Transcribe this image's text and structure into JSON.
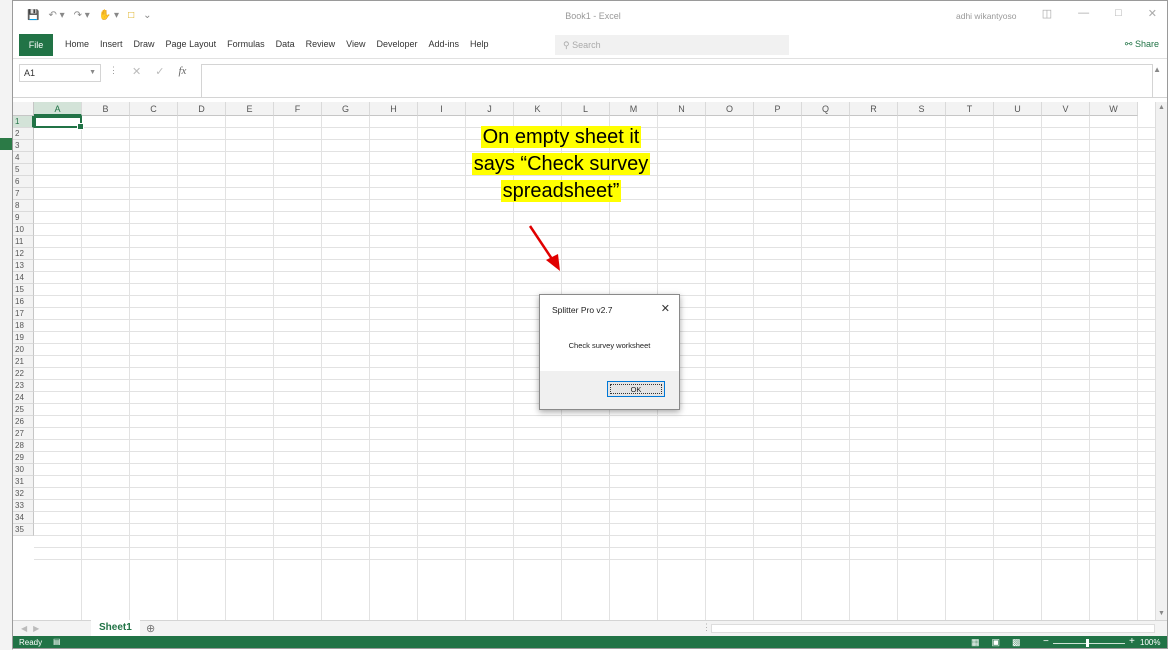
{
  "titlebar": {
    "doc_title": "Book1 - Excel",
    "user": "adhi wikantyoso",
    "window_controls": [
      "ribbon-display-icon",
      "minimize-icon",
      "restore-icon",
      "close-icon"
    ]
  },
  "ribbon": {
    "file_label": "File",
    "tabs": [
      "Home",
      "Insert",
      "Draw",
      "Page Layout",
      "Formulas",
      "Data",
      "Review",
      "View",
      "Developer",
      "Add-ins",
      "Help"
    ],
    "search_placeholder": "Search",
    "share_label": "Share"
  },
  "formula_bar": {
    "name_box": "A1",
    "fx_label": "fx",
    "value": ""
  },
  "grid": {
    "columns": [
      "A",
      "B",
      "C",
      "D",
      "E",
      "F",
      "G",
      "H",
      "I",
      "J",
      "K",
      "L",
      "M",
      "N",
      "O",
      "P",
      "Q",
      "R",
      "S",
      "T",
      "U",
      "V",
      "W"
    ],
    "rows": [
      "1",
      "2",
      "3",
      "4",
      "5",
      "6",
      "7",
      "8",
      "9",
      "10",
      "11",
      "12",
      "13",
      "14",
      "15",
      "16",
      "17",
      "18",
      "19",
      "20",
      "21",
      "22",
      "23",
      "24",
      "25",
      "26",
      "27",
      "28",
      "29",
      "30",
      "31",
      "32",
      "33",
      "34",
      "35"
    ],
    "selected_cell": "A1"
  },
  "sheets": {
    "tabs": [
      "Sheet1"
    ],
    "active": "Sheet1"
  },
  "status": {
    "ready": "Ready",
    "zoom": "100%"
  },
  "dialog": {
    "title": "Splitter Pro v2.7",
    "message": "Check survey worksheet",
    "ok_label": "OK",
    "close_glyph": "✕"
  },
  "annotation": {
    "lines": [
      "On empty sheet it",
      "says “Check survey",
      "spreadsheet”"
    ],
    "arrow_color": "#e00000",
    "highlight_color": "#ffff00"
  },
  "colors": {
    "excel_green": "#217346"
  }
}
